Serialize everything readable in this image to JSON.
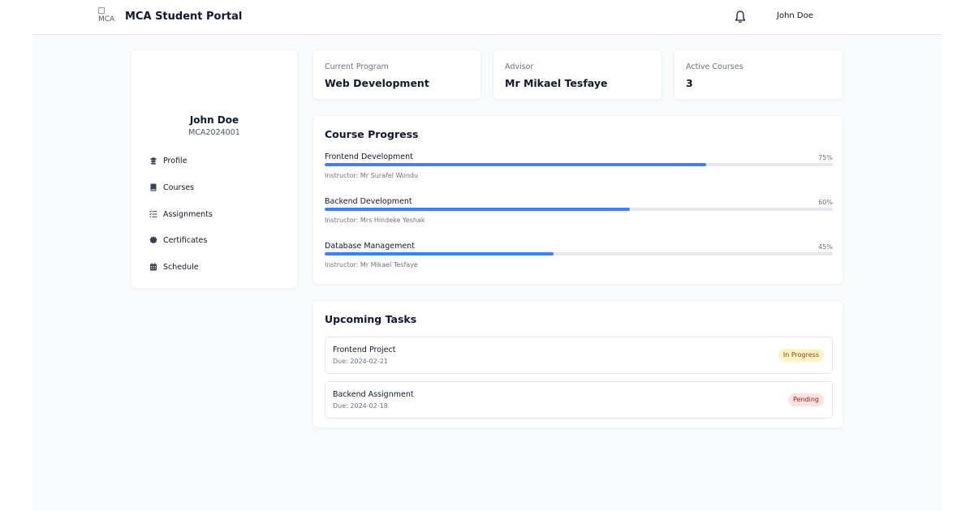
{
  "header": {
    "logo_alt": "MCA",
    "title": "MCA Student Portal",
    "user_name": "John Doe",
    "bell_icon": "bell-icon"
  },
  "sidebar": {
    "name": "John Doe",
    "student_id": "MCA2024001",
    "items": [
      {
        "label": "Profile",
        "icon": "graduation-cap-icon"
      },
      {
        "label": "Courses",
        "icon": "book-icon"
      },
      {
        "label": "Assignments",
        "icon": "list-icon"
      },
      {
        "label": "Certificates",
        "icon": "certificate-icon"
      },
      {
        "label": "Schedule",
        "icon": "calendar-icon"
      }
    ]
  },
  "stats": [
    {
      "label": "Current Program",
      "value": "Web Development"
    },
    {
      "label": "Advisor",
      "value": "Mr Mikael Tesfaye"
    },
    {
      "label": "Active Courses",
      "value": "3"
    }
  ],
  "progress": {
    "title": "Course Progress",
    "courses": [
      {
        "name": "Frontend Development",
        "percent_label": "75%",
        "percent": 75,
        "instructor": "Instructor: Mr Surafel Wondu"
      },
      {
        "name": "Backend Development",
        "percent_label": "60%",
        "percent": 60,
        "instructor": "Instructor: Mrs Hindeke Yeshak"
      },
      {
        "name": "Database Management",
        "percent_label": "45%",
        "percent": 45,
        "instructor": "Instructor: Mr Mikael Tesfaye"
      }
    ]
  },
  "tasks": {
    "title": "Upcoming Tasks",
    "items": [
      {
        "name": "Frontend Project",
        "due": "Due: 2024-02-21",
        "status": "In Progress"
      },
      {
        "name": "Backend Assignment",
        "due": "Due: 2024-02-18",
        "status": "Pending"
      }
    ]
  },
  "colors": {
    "accent": "#3b82f6",
    "in_progress_bg": "#fef3c7",
    "pending_bg": "#fee2e2"
  }
}
